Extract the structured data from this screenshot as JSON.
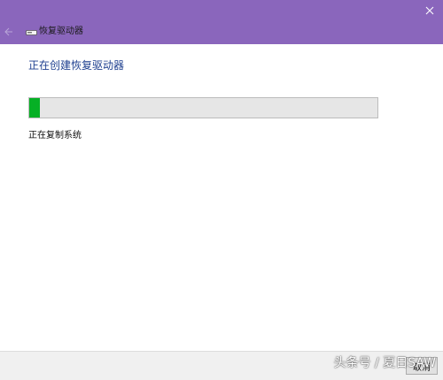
{
  "window": {
    "title": "恢复驱动器",
    "accent_color": "#8a66bc",
    "close_icon": "close-icon",
    "back_icon": "back-arrow-icon",
    "drive_icon": "drive-icon"
  },
  "main": {
    "heading": "正在创建恢复驱动器",
    "heading_color": "#1e3f8f",
    "progress_percent": 3,
    "progress_color": "#06b025",
    "status": "正在复制系统"
  },
  "footer": {
    "cancel_label": "取消"
  },
  "watermark": {
    "text": "头条号 / 夏日SAW"
  }
}
